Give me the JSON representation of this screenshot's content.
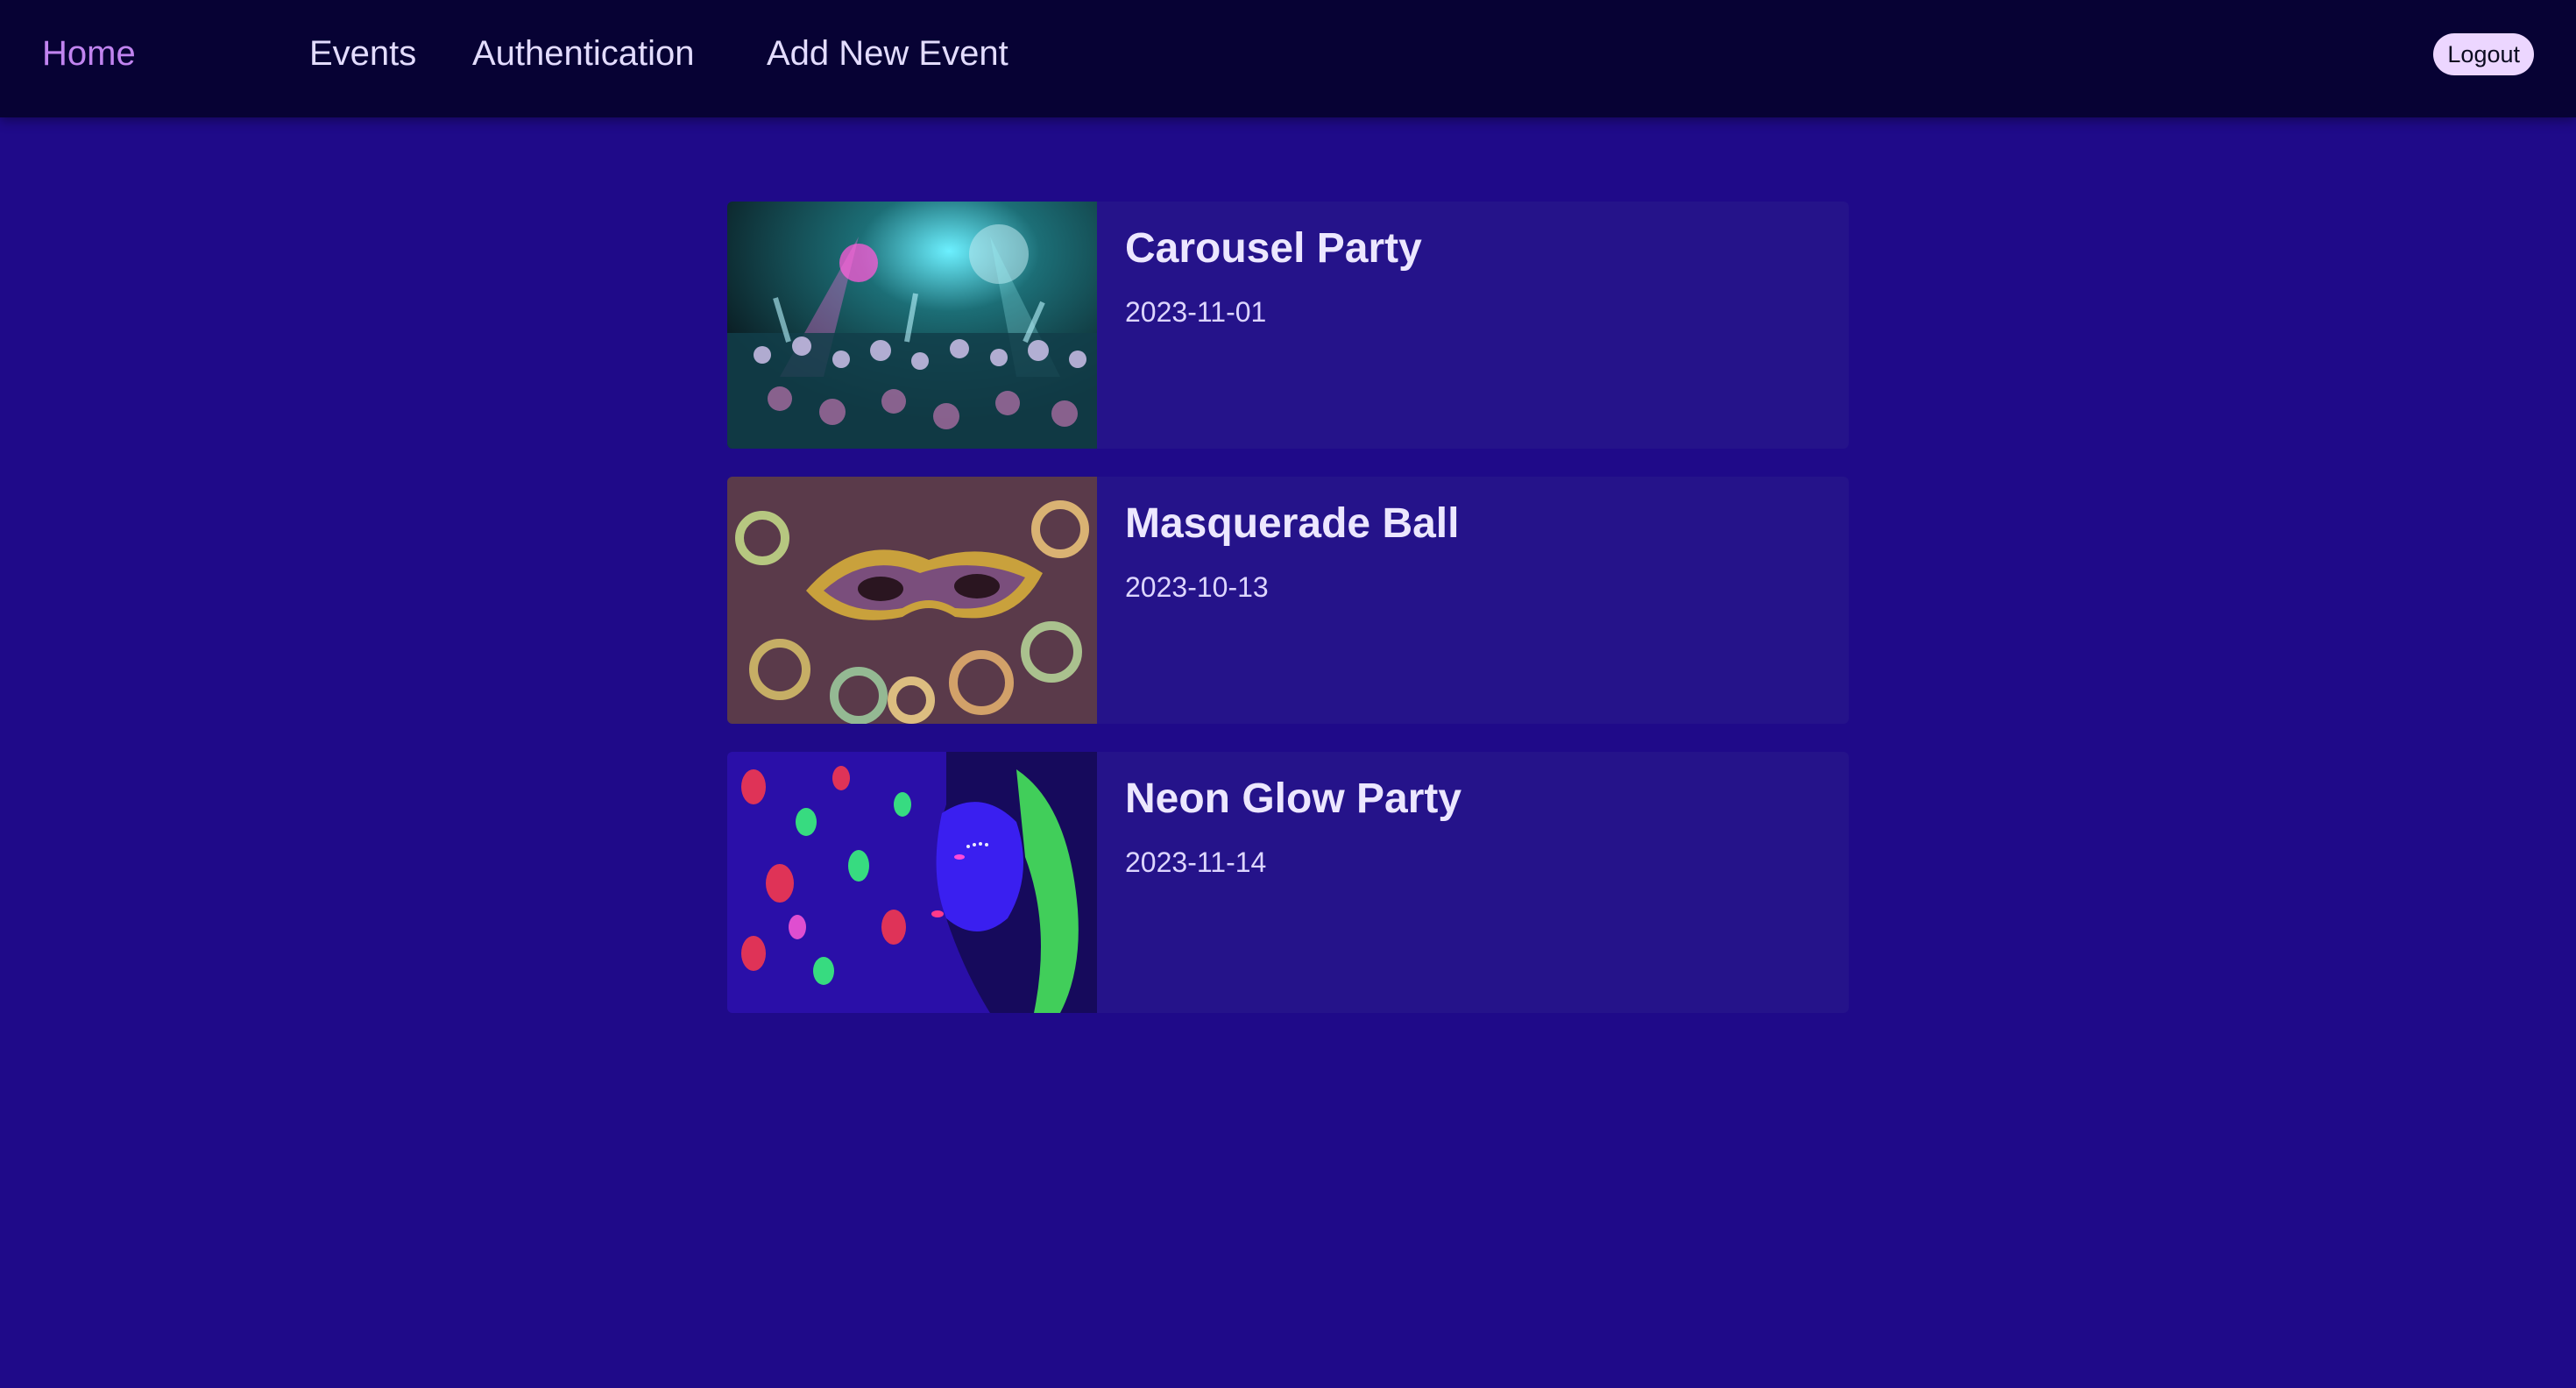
{
  "nav": {
    "home": "Home",
    "events": "Events",
    "authentication": "Authentication",
    "add_new_event": "Add New Event",
    "logout": "Logout"
  },
  "events": [
    {
      "title": "Carousel Party",
      "date": "2023-11-01",
      "image": "party-crowd-photo"
    },
    {
      "title": "Masquerade Ball",
      "date": "2023-10-13",
      "image": "masquerade-mask-photo"
    },
    {
      "title": "Neon Glow Party",
      "date": "2023-11-14",
      "image": "neon-portrait-photo"
    }
  ],
  "colors": {
    "background": "#1f0a89",
    "topbar": "#070234",
    "active_link": "#c184f0",
    "card": "#25138a",
    "logout_button": "#ecd6ff"
  }
}
